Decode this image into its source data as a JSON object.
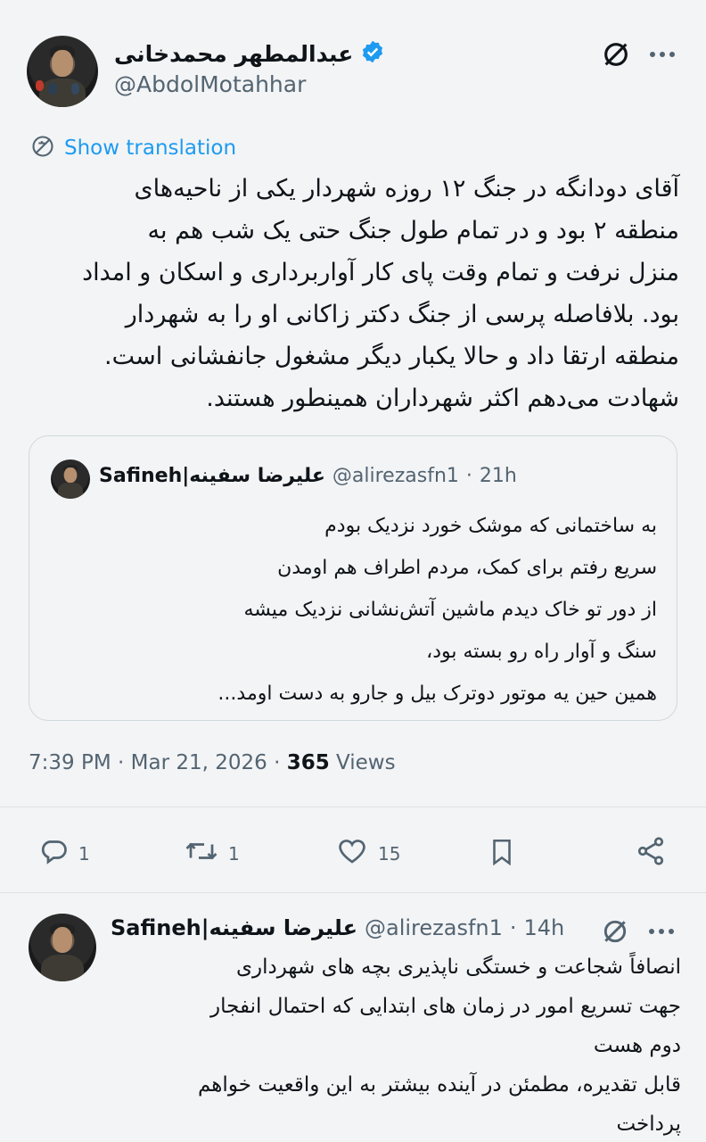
{
  "tweet": {
    "author_name": "عبدالمطهر محمدخانی",
    "author_handle": "@AbdolMotahhar",
    "translate_label": "Show translation",
    "text_lines": [
      "آقای دودانگه در جنگ ۱۲ روزه شهردار یکی از ناحیه‌های",
      "منطقه ۲ بود و در تمام طول جنگ حتی یک شب هم به",
      "منزل نرفت و تمام وقت پای کار آواربرداری و اسکان و امداد",
      "بود. بلافاصله پرسی از جنگ دکتر زاکانی او را به شهردار",
      "منطقه ارتقا داد و حالا یکبار دیگر مشغول جانفشانی است.",
      "شهادت می‌دهم اکثر شهرداران همینطور هستند."
    ],
    "time": "7:39 PM",
    "date": "Mar 21, 2026",
    "views_count": "365",
    "views_label": "Views",
    "replies": "1",
    "retweets": "1",
    "likes": "15"
  },
  "quote": {
    "author_name": "Safineh|علیرضا سفینه",
    "author_handle": "@alirezasfn1",
    "time_ago": "21h",
    "text_lines": [
      "به ساختمانی که موشک خورد نزدیک بودم",
      "سریع رفتم برای کمک، مردم اطراف هم اومدن",
      "از دور تو خاک دیدم ماشین آتش‌نشانی نزدیک میشه",
      "سنگ و آوار راه رو بسته بود،",
      "همین حین یه موتور دوترک بیل و جارو به دست اومد..."
    ]
  },
  "reply": {
    "author_name": "Safineh|علیرضا سفینه",
    "author_handle": "@alirezasfn1",
    "time_ago": "14h",
    "text_lines": [
      "انصافاً شجاعت و خستگی ناپذیری بچه های شهرداری",
      "جهت تسریع امور در زمان های ابتدایی که احتمال انفجار",
      "دوم هست",
      "قابل تقدیره، مطمئن در آینده بیشتر به این واقعیت خواهم",
      "پرداخت"
    ]
  },
  "colors": {
    "verified": "#1d9bf0",
    "link": "#1d9bf0",
    "secondary_text": "#536471",
    "background": "#f3f4f6"
  },
  "icons": [
    "verified-badge-icon",
    "grok-icon",
    "more-icon",
    "translate-icon",
    "reply-icon",
    "retweet-icon",
    "like-icon",
    "bookmark-icon",
    "share-icon"
  ]
}
